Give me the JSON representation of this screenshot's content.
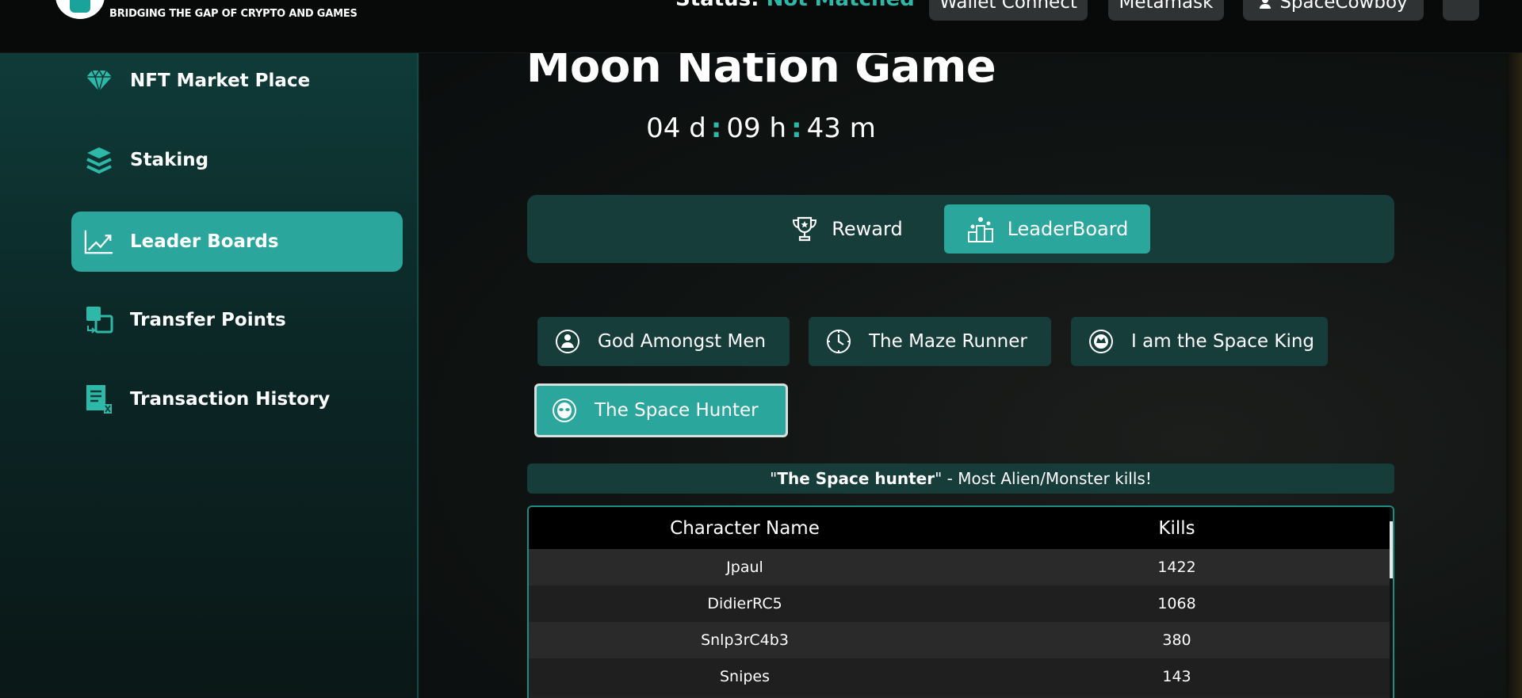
{
  "header": {
    "tagline": "BRIDGING THE GAP OF CRYPTO AND GAMES",
    "status_label": "Status:",
    "status_value": "Not Matched",
    "buttons": {
      "wallet_connect": "Wallet Connect",
      "metamask": "Metamask",
      "user": "SpaceCowboy"
    }
  },
  "sidebar": {
    "items": [
      {
        "label": "NFT Market Place",
        "icon": "diamond-icon",
        "active": false
      },
      {
        "label": "Staking",
        "icon": "layers-icon",
        "active": false
      },
      {
        "label": "Leader Boards",
        "icon": "chart-line-icon",
        "active": true
      },
      {
        "label": "Transfer Points",
        "icon": "transfer-icon",
        "active": false
      },
      {
        "label": "Transaction History",
        "icon": "receipt-icon",
        "active": false
      }
    ]
  },
  "main": {
    "title": "Moon Nation Game",
    "timer": {
      "days": "04",
      "days_unit": "d",
      "hours": "09",
      "hours_unit": "h",
      "minutes": "43",
      "minutes_unit": "m",
      "separator": ":"
    },
    "tabs": [
      {
        "label": "Reward",
        "icon": "trophy-icon",
        "active": false
      },
      {
        "label": "LeaderBoard",
        "icon": "podium-icon",
        "active": true
      }
    ],
    "categories": [
      {
        "label": "God Amongst Men",
        "icon": "person-badge-icon",
        "active": false
      },
      {
        "label": "The Maze Runner",
        "icon": "clock-icon",
        "active": false
      },
      {
        "label": "I am the Space King",
        "icon": "crown-badge-icon",
        "active": false
      },
      {
        "label": "The Space Hunter",
        "icon": "alien-icon",
        "active": true
      }
    ],
    "description": {
      "open_quote": "\"",
      "title": "The Space hunter",
      "close_quote": "\"",
      "text": " - Most Alien/Monster kills!"
    },
    "table": {
      "headers": [
        "Character Name",
        "Kills"
      ],
      "rows": [
        [
          "Jpaul",
          "1422"
        ],
        [
          "DidierRC5",
          "1068"
        ],
        [
          "Snlp3rC4b3",
          "380"
        ],
        [
          "Snipes",
          "143"
        ]
      ]
    }
  },
  "colors": {
    "accent": "#2aa69c",
    "panel": "#163d3a",
    "status_value": "#2eb8a8"
  }
}
